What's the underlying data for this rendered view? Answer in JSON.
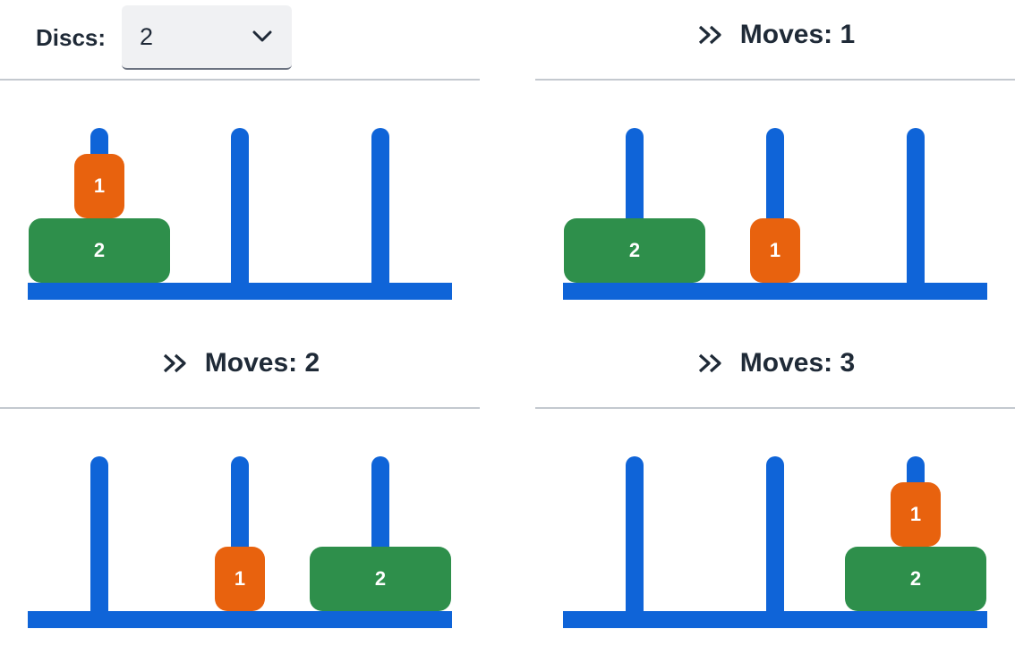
{
  "controls": {
    "discs_label": "Discs:",
    "discs_value": "2"
  },
  "colors": {
    "peg": "#0f64d8",
    "disc_1": "#e8620e",
    "disc_2": "#2e8f4b",
    "divider": "#c4c9cf",
    "text": "#1f2a37"
  },
  "icons": {
    "select": "chevron-down-icon",
    "move": "double-chevron-right-icon"
  },
  "panels": [
    {
      "title": "",
      "pegs": [
        [
          "2",
          "1"
        ],
        [],
        []
      ]
    },
    {
      "title": "Moves: 1",
      "pegs": [
        [
          "2"
        ],
        [
          "1"
        ],
        []
      ]
    },
    {
      "title": "Moves: 2",
      "pegs": [
        [],
        [
          "1"
        ],
        [
          "2"
        ]
      ]
    },
    {
      "title": "Moves: 3",
      "pegs": [
        [],
        [],
        [
          "2",
          "1"
        ]
      ]
    }
  ]
}
